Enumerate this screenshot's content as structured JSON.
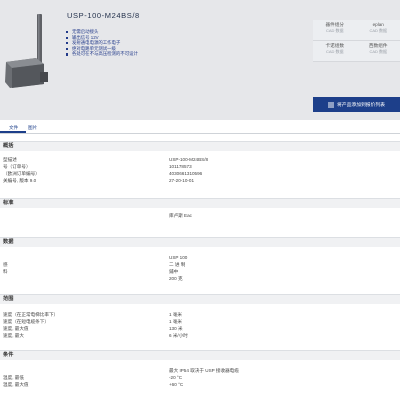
{
  "product": {
    "title": "USP-100-M24BS/8",
    "bullets": [
      "无需启动接头",
      "输出信号 12V",
      "发射通电电源的工作电子",
      "绝对电路单元测试一级",
      "各处可在不与高压检测的不可设计"
    ]
  },
  "side_links": [
    [
      {
        "label": "器件组分",
        "sub": "CAD 数据"
      },
      {
        "label": "eplan",
        "sub": "CAD 数据"
      }
    ],
    [
      {
        "label": "卡诺组数",
        "sub": "CAD 数据"
      },
      {
        "label": "西数组件",
        "sub": "CAD 数据"
      }
    ]
  ],
  "cta": {
    "label": "将产品添加到报价列表"
  },
  "tabs": [
    "文件",
    "图片"
  ],
  "sections": [
    {
      "title": "概括",
      "rows": [
        {
          "k": "型描述",
          "v": "USP-100-M24BS/8"
        },
        {
          "k": "号（订单号）",
          "v": "101178573"
        },
        {
          "k": "（欧洲订单编号）",
          "v": "4030661310596"
        },
        {
          "k": "关编号, 版本 9.0",
          "v": "27-20-10-01"
        }
      ]
    },
    {
      "title": "标准",
      "rows": [
        {
          "k": "",
          "v": "库卢斯 Eac"
        }
      ]
    },
    {
      "title": "数据",
      "rows": [
        {
          "k": "",
          "v": "USP 100"
        },
        {
          "k": "感",
          "v": "二 进 制"
        },
        {
          "k": "料",
          "v": "鋪中"
        },
        {
          "k": "",
          "v": "200 克"
        }
      ]
    },
    {
      "title": "范围",
      "rows": [
        {
          "k": "速度（在正常电梯比率下）",
          "v": "1 毫米"
        },
        {
          "k": "速度（在短电缆条下）",
          "v": "1 毫米"
        },
        {
          "k": "速度, 最大值",
          "v": "130 米"
        },
        {
          "k": "速度, 最大",
          "v": "6 米/小时"
        }
      ]
    },
    {
      "title": "条件",
      "rows": [
        {
          "k": "",
          "v": "最大 IP54 取决于 USP 接收器电缆"
        },
        {
          "k": "温度, 最低",
          "v": "-20 °C"
        },
        {
          "k": "温度, 最大值",
          "v": "+60 °C"
        }
      ]
    }
  ]
}
